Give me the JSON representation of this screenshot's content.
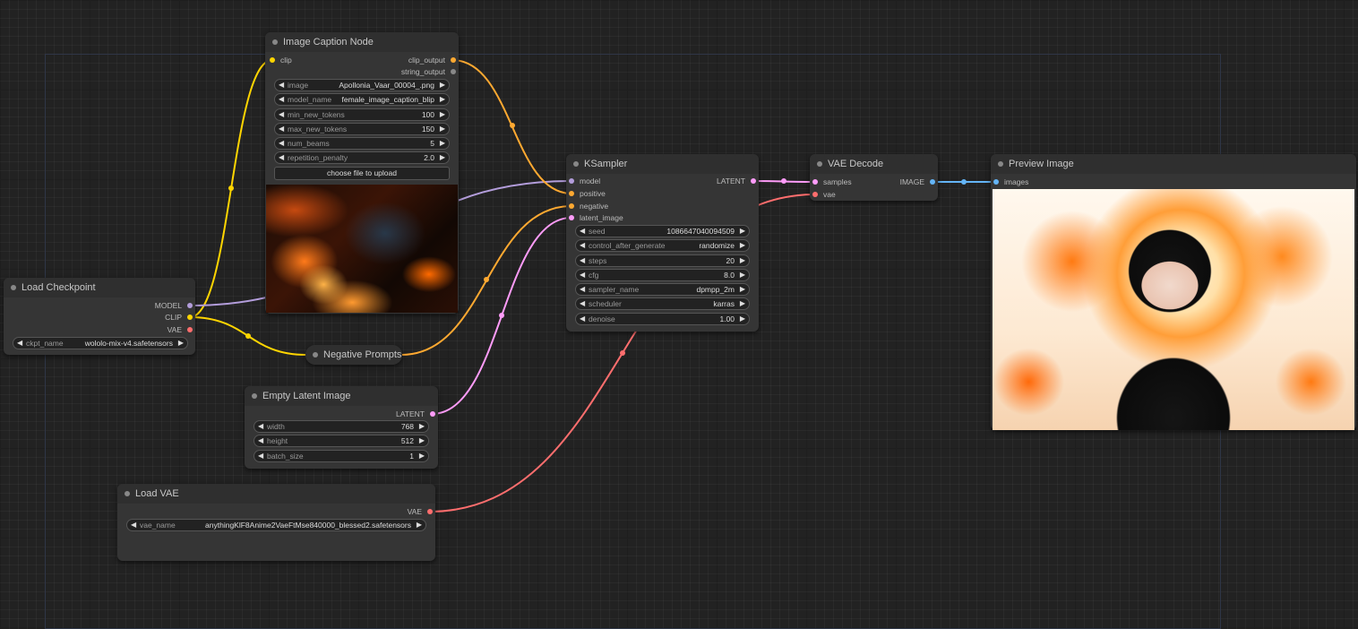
{
  "nodes": {
    "image_caption": {
      "title": "Image Caption Node",
      "inputs": {
        "clip": "clip"
      },
      "outputs": {
        "clip_output": "clip_output",
        "string_output": "string_output"
      },
      "widgets": [
        {
          "name": "image",
          "value": "Apollonia_Vaar_00004_.png"
        },
        {
          "name": "model_name",
          "value": "female_image_caption_blip"
        },
        {
          "name": "min_new_tokens",
          "value": "100"
        },
        {
          "name": "max_new_tokens",
          "value": "150"
        },
        {
          "name": "num_beams",
          "value": "5"
        },
        {
          "name": "repetition_penalty",
          "value": "2.0"
        }
      ],
      "upload_label": "choose file to upload"
    },
    "ksampler": {
      "title": "KSampler",
      "inputs": {
        "model": "model",
        "positive": "positive",
        "negative": "negative",
        "latent_image": "latent_image"
      },
      "outputs": {
        "latent": "LATENT"
      },
      "widgets": [
        {
          "name": "seed",
          "value": "1086647040094509"
        },
        {
          "name": "control_after_generate",
          "value": "randomize"
        },
        {
          "name": "steps",
          "value": "20"
        },
        {
          "name": "cfg",
          "value": "8.0"
        },
        {
          "name": "sampler_name",
          "value": "dpmpp_2m"
        },
        {
          "name": "scheduler",
          "value": "karras"
        },
        {
          "name": "denoise",
          "value": "1.00"
        }
      ]
    },
    "vae_decode": {
      "title": "VAE Decode",
      "inputs": {
        "samples": "samples",
        "vae": "vae"
      },
      "outputs": {
        "image": "IMAGE"
      }
    },
    "preview_image": {
      "title": "Preview Image",
      "inputs": {
        "images": "images"
      }
    },
    "load_checkpoint": {
      "title": "Load Checkpoint",
      "outputs": {
        "model": "MODEL",
        "clip": "CLIP",
        "vae": "VAE"
      },
      "widgets": [
        {
          "name": "ckpt_name",
          "value": "wololo-mix-v4.safetensors"
        }
      ]
    },
    "negative_prompts": {
      "title": "Negative Prompts"
    },
    "empty_latent": {
      "title": "Empty Latent Image",
      "outputs": {
        "latent": "LATENT"
      },
      "widgets": [
        {
          "name": "width",
          "value": "768"
        },
        {
          "name": "height",
          "value": "512"
        },
        {
          "name": "batch_size",
          "value": "1"
        }
      ]
    },
    "load_vae": {
      "title": "Load VAE",
      "outputs": {
        "vae": "VAE"
      },
      "widgets": [
        {
          "name": "vae_name",
          "value": "anythingKlF8Anime2VaeFtMse840000_blessed2.safetensors"
        }
      ]
    }
  },
  "colors": {
    "model": "#b39ddb",
    "clip": "#ffd500",
    "conditioning": "#ffa931",
    "latent": "#ff9cf9",
    "vae": "#ff6e6e",
    "image": "#64b5f6",
    "string": "#888888"
  }
}
